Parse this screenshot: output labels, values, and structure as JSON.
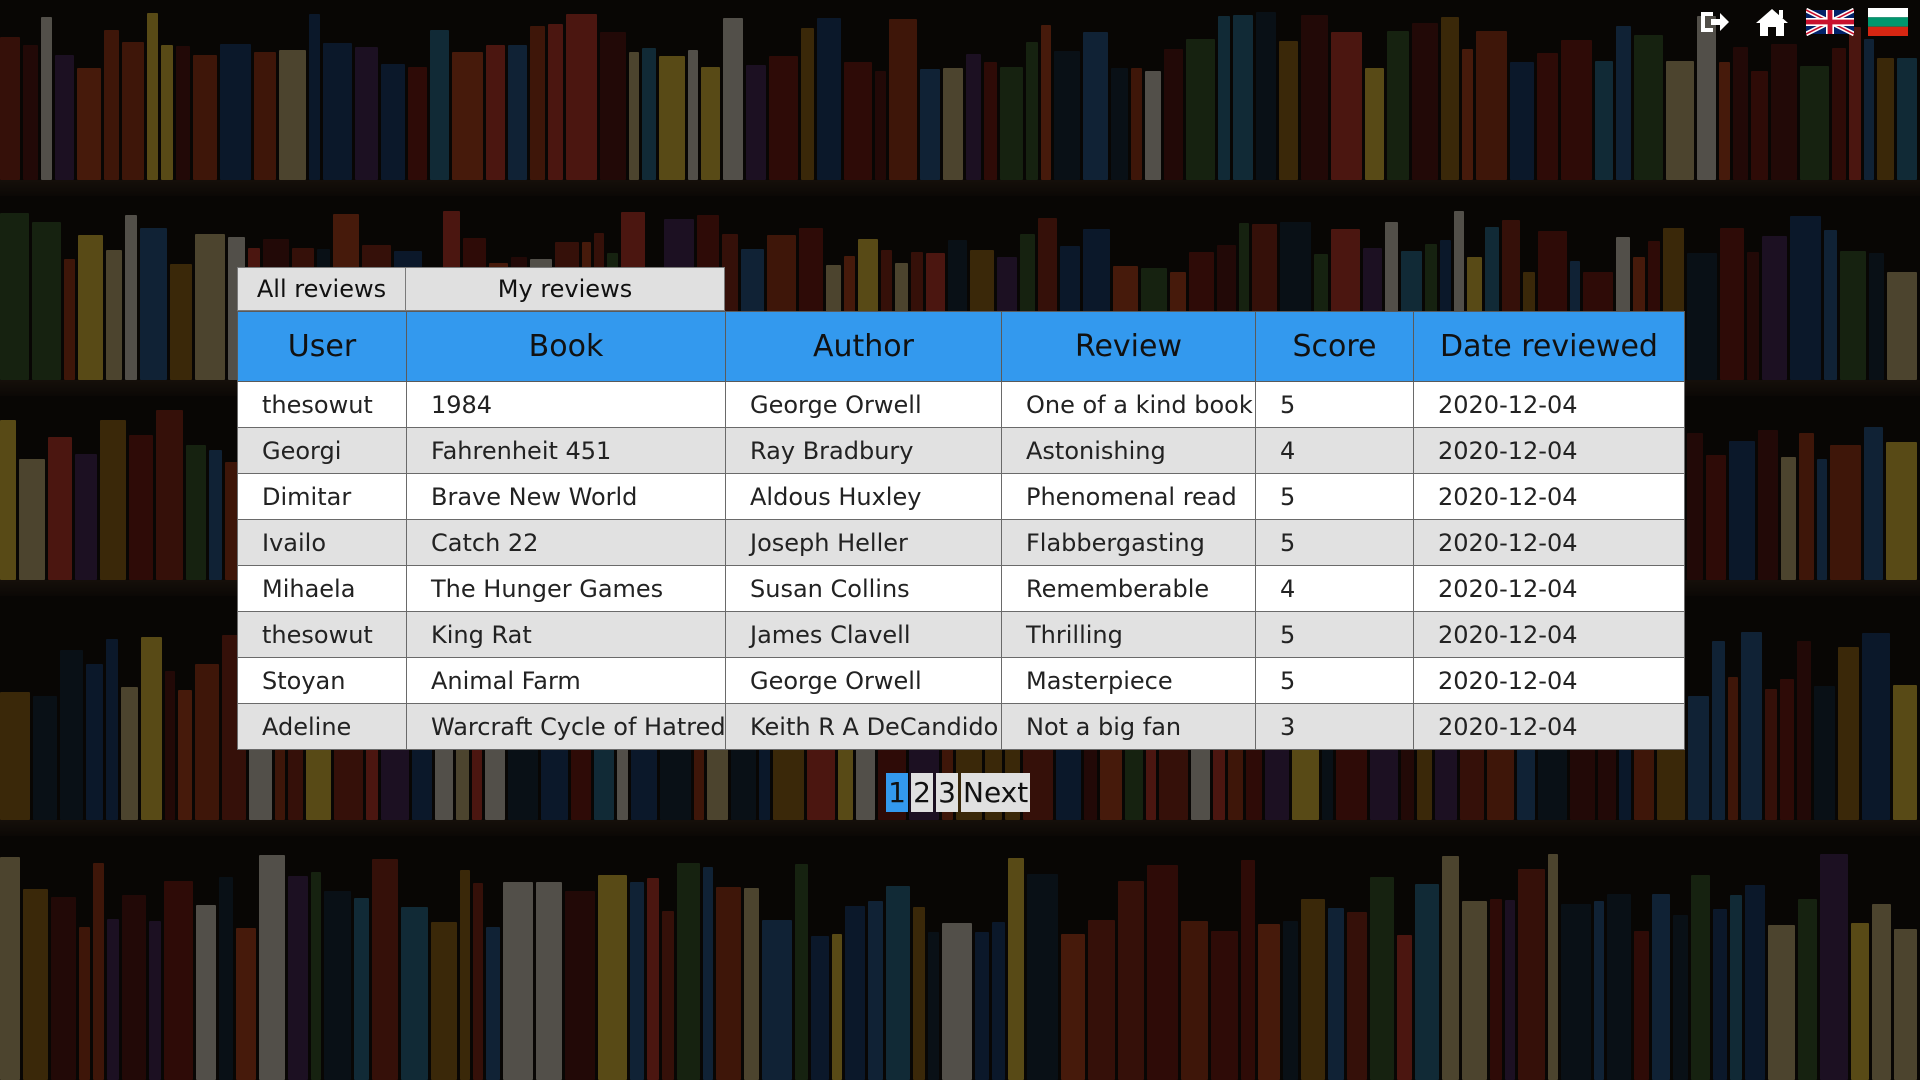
{
  "top_icons": [
    {
      "name": "logout-icon"
    },
    {
      "name": "home-icon"
    },
    {
      "name": "uk-flag-icon"
    },
    {
      "name": "bulgaria-flag-icon"
    }
  ],
  "tabs": {
    "all": "All reviews",
    "mine": "My reviews"
  },
  "table": {
    "headers": [
      "User",
      "Book",
      "Author",
      "Review",
      "Score",
      "Date reviewed"
    ],
    "rows": [
      [
        "thesowut",
        "1984",
        "George Orwell",
        "One of a kind book",
        "5",
        "2020-12-04"
      ],
      [
        "Georgi",
        "Fahrenheit 451",
        "Ray Bradbury",
        "Astonishing",
        "4",
        "2020-12-04"
      ],
      [
        "Dimitar",
        "Brave New World",
        "Aldous Huxley",
        "Phenomenal read",
        "5",
        "2020-12-04"
      ],
      [
        "Ivailo",
        "Catch 22",
        "Joseph Heller",
        "Flabbergasting",
        "5",
        "2020-12-04"
      ],
      [
        "Mihaela",
        "The Hunger Games",
        "Susan Collins",
        "Rememberable",
        "4",
        "2020-12-04"
      ],
      [
        "thesowut",
        "King Rat",
        "James Clavell",
        "Thrilling",
        "5",
        "2020-12-04"
      ],
      [
        "Stoyan",
        "Animal Farm",
        "George Orwell",
        "Masterpiece",
        "5",
        "2020-12-04"
      ],
      [
        "Adeline",
        "Warcraft Cycle of Hatred",
        "Keith R A DeCandido",
        "Not a big fan",
        "3",
        "2020-12-04"
      ]
    ]
  },
  "pagination": {
    "pages": [
      "1",
      "2",
      "3"
    ],
    "active": "1",
    "next_label": "Next"
  },
  "colors": {
    "accent": "#3399ee",
    "row_alt": "#e1e1e1",
    "tab_bg": "#e0e0e0"
  }
}
